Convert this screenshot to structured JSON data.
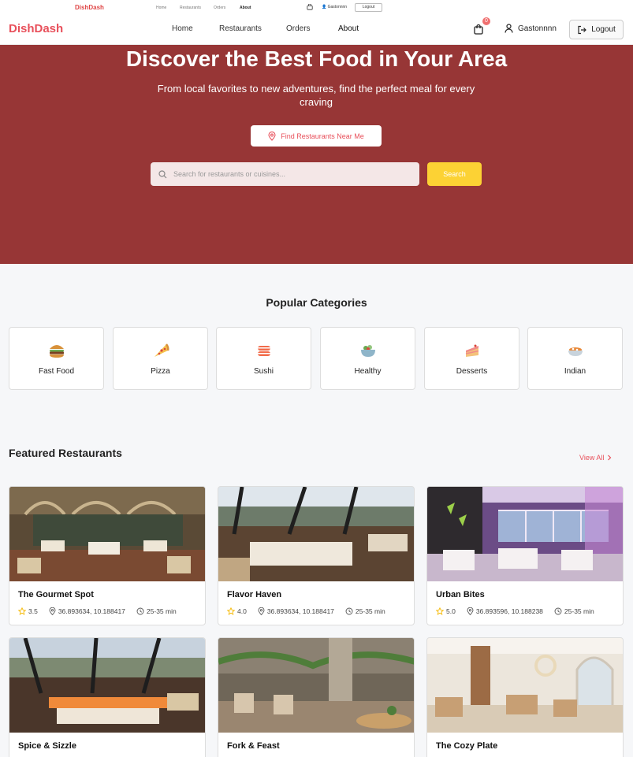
{
  "mini_header": {
    "brand": "DishDash",
    "nav": [
      "Home",
      "Restaurants",
      "Orders",
      "About"
    ],
    "username": "Gastonnnn",
    "logout": "Logout"
  },
  "header": {
    "brand": "DishDash",
    "nav": [
      "Home",
      "Restaurants",
      "Orders",
      "About"
    ],
    "cart_count": "0",
    "username": "Gastonnnn",
    "logout": "Logout"
  },
  "hero": {
    "title": "Discover the Best Food in Your Area",
    "subtitle": "From local favorites to new adventures, find the perfect meal for every craving",
    "locate_label": "Find Restaurants Near Me",
    "search_placeholder": "Search for restaurants or cuisines...",
    "search_button": "Search"
  },
  "categories": {
    "title": "Popular Categories",
    "items": [
      {
        "label": "Fast Food",
        "icon": "burger-icon"
      },
      {
        "label": "Pizza",
        "icon": "pizza-icon"
      },
      {
        "label": "Sushi",
        "icon": "sushi-icon"
      },
      {
        "label": "Healthy",
        "icon": "salad-icon"
      },
      {
        "label": "Desserts",
        "icon": "cake-icon"
      },
      {
        "label": "Indian",
        "icon": "curry-icon"
      }
    ]
  },
  "featured": {
    "title": "Featured Restaurants",
    "view_all": "View All",
    "restaurants": [
      {
        "name": "The Gourmet Spot",
        "rating": "3.5",
        "location": "36.893634, 10.188417",
        "time": "25-35 min"
      },
      {
        "name": "Flavor Haven",
        "rating": "4.0",
        "location": "36.893634, 10.188417",
        "time": "25-35 min"
      },
      {
        "name": "Urban Bites",
        "rating": "5.0",
        "location": "36.893596, 10.188238",
        "time": "25-35 min"
      },
      {
        "name": "Spice & Sizzle"
      },
      {
        "name": "Fork & Feast"
      },
      {
        "name": "The Cozy Plate"
      }
    ]
  },
  "colors": {
    "brand": "#e8505b",
    "hero_bg": "#973636",
    "search_button": "#fcd234",
    "star": "#f5b800"
  }
}
